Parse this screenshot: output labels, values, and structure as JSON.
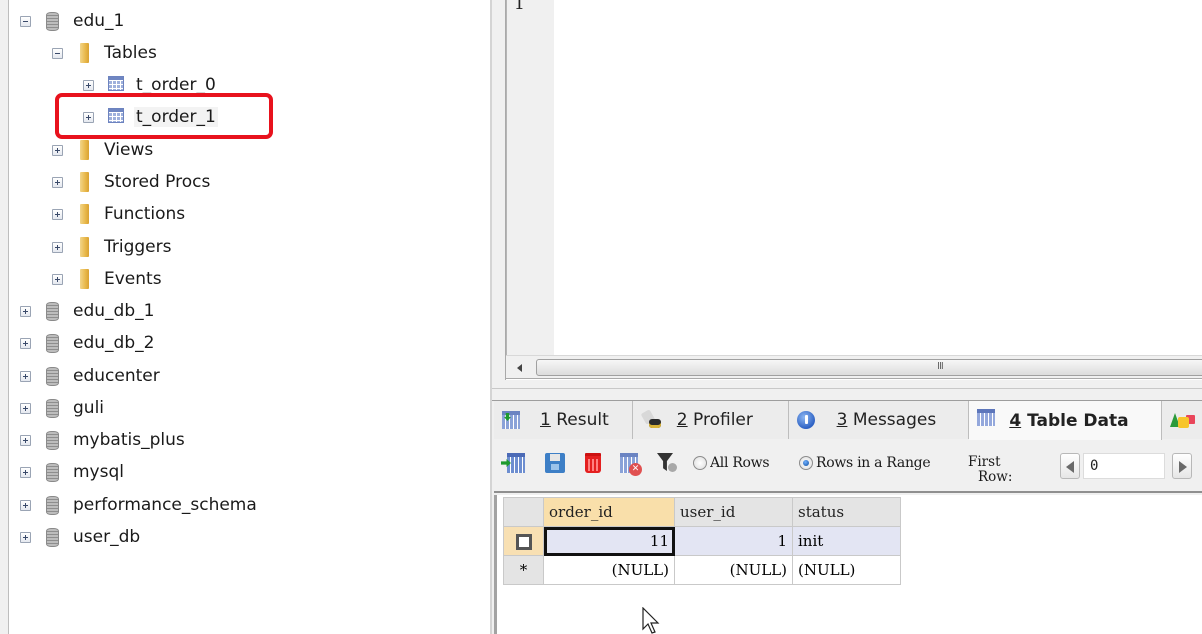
{
  "tree": {
    "items": [
      {
        "type": "database",
        "label": "edu_1",
        "expanded": true,
        "level": 0
      },
      {
        "type": "folder",
        "label": "Tables",
        "expanded": true,
        "level": 1
      },
      {
        "type": "table",
        "label": "t_order_0",
        "expanded": false,
        "level": 2
      },
      {
        "type": "table",
        "label": "t_order_1",
        "expanded": false,
        "level": 2,
        "highlighted": true
      },
      {
        "type": "folder",
        "label": "Views",
        "expanded": false,
        "level": 1
      },
      {
        "type": "folder",
        "label": "Stored Procs",
        "expanded": false,
        "level": 1
      },
      {
        "type": "folder",
        "label": "Functions",
        "expanded": false,
        "level": 1
      },
      {
        "type": "folder",
        "label": "Triggers",
        "expanded": false,
        "level": 1
      },
      {
        "type": "folder",
        "label": "Events",
        "expanded": false,
        "level": 1
      },
      {
        "type": "database",
        "label": "edu_db_1",
        "expanded": false,
        "level": 0
      },
      {
        "type": "database",
        "label": "edu_db_2",
        "expanded": false,
        "level": 0
      },
      {
        "type": "database",
        "label": "educenter",
        "expanded": false,
        "level": 0
      },
      {
        "type": "database",
        "label": "guli",
        "expanded": false,
        "level": 0
      },
      {
        "type": "database",
        "label": "mybatis_plus",
        "expanded": false,
        "level": 0
      },
      {
        "type": "database",
        "label": "mysql",
        "expanded": false,
        "level": 0
      },
      {
        "type": "database",
        "label": "performance_schema",
        "expanded": false,
        "level": 0
      },
      {
        "type": "database",
        "label": "user_db",
        "expanded": false,
        "level": 0
      }
    ],
    "highlight_color": "#e8121d"
  },
  "editor": {
    "line_numbers": [
      "1"
    ],
    "scroll_grip": "III"
  },
  "result_tabs": [
    {
      "num": "1",
      "label": "Result",
      "icon": "result-grid-icon",
      "active": false
    },
    {
      "num": "2",
      "label": "Profiler",
      "icon": "profiler-binoculars-icon",
      "active": false
    },
    {
      "num": "3",
      "label": "Messages",
      "icon": "info-icon",
      "active": false
    },
    {
      "num": "4",
      "label": "Table Data",
      "icon": "table-data-icon",
      "active": true
    },
    {
      "num": "",
      "label": "",
      "icon": "info-shapes-icon",
      "active": false
    }
  ],
  "toolbar": {
    "buttons": [
      "insert-row-icon",
      "save-icon",
      "delete-icon",
      "cancel-changes-icon",
      "filter-icon"
    ],
    "radio_all_label": "All Rows",
    "radio_range_label": "Rows in a Range",
    "range_selected": true,
    "first_row_label_line1": "First",
    "first_row_label_line2": "Row:",
    "first_row_value": "0"
  },
  "grid": {
    "columns": [
      "order_id",
      "user_id",
      "status"
    ],
    "sorted_column": "order_id",
    "rows": [
      {
        "marker": "checkbox",
        "order_id": "11",
        "user_id": "1",
        "status": "init"
      },
      {
        "marker": "*",
        "order_id": "(NULL)",
        "user_id": "(NULL)",
        "status": "(NULL)"
      }
    ]
  }
}
